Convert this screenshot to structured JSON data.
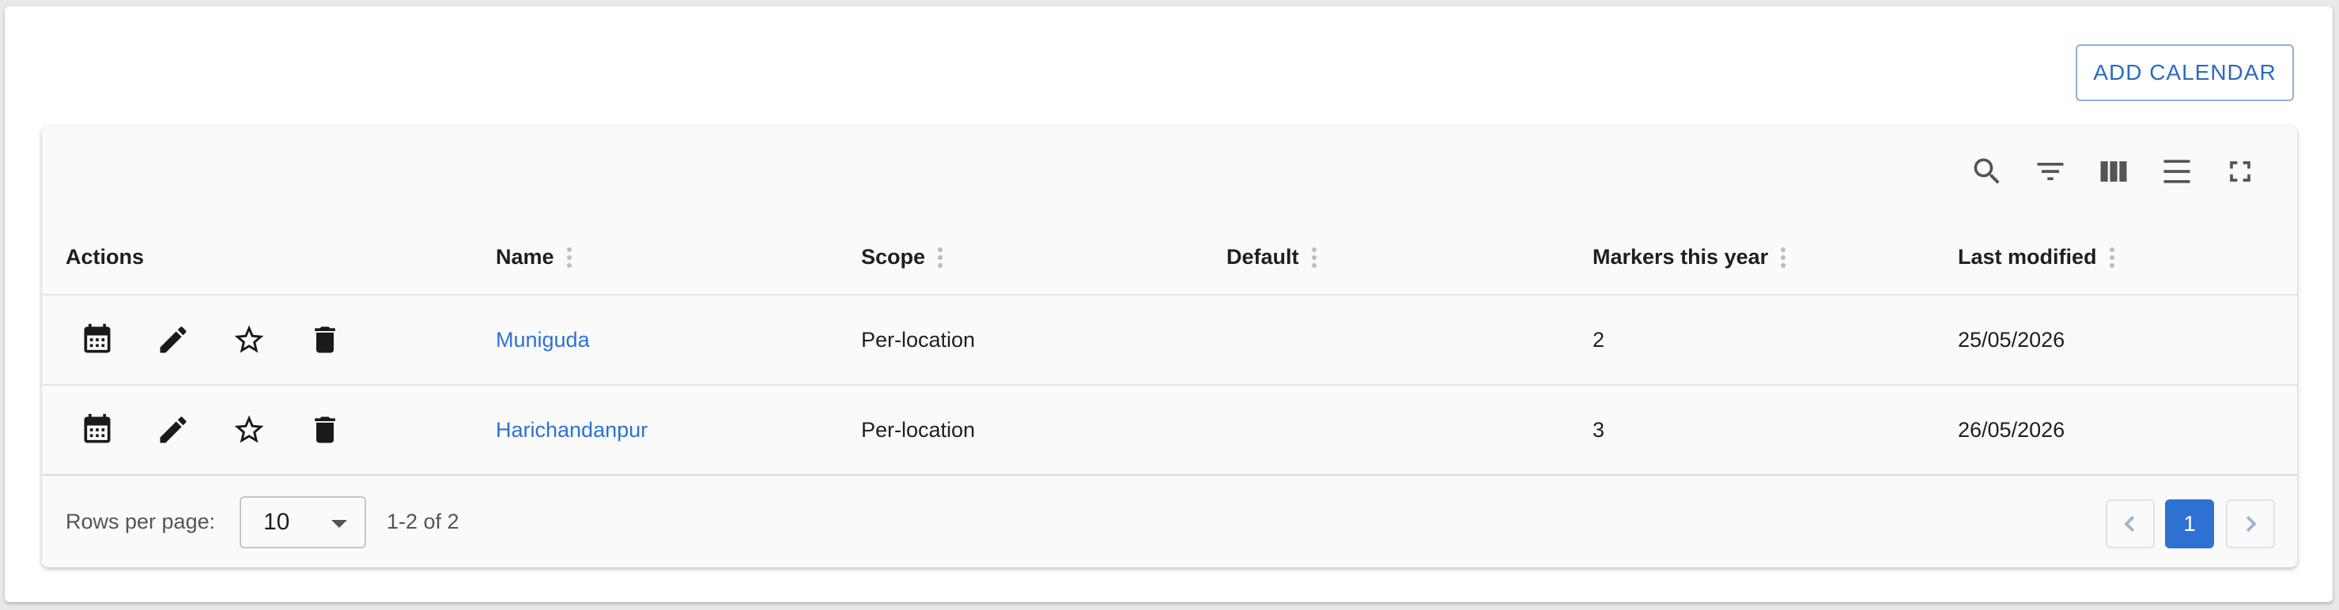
{
  "header": {
    "add_button": "ADD CALENDAR"
  },
  "toolbar": {
    "icons": [
      "search-icon",
      "filter-icon",
      "columns-icon",
      "density-icon",
      "fullscreen-icon"
    ]
  },
  "table": {
    "columns": [
      "Actions",
      "Name",
      "Scope",
      "Default",
      "Markers this year",
      "Last modified"
    ],
    "row_actions": [
      "calendar-icon",
      "edit-icon",
      "star-outline-icon",
      "delete-icon"
    ],
    "rows": [
      {
        "name": "Muniguda",
        "scope": "Per-location",
        "default": "",
        "markers": "2",
        "modified": "25/05/2026"
      },
      {
        "name": "Harichandanpur",
        "scope": "Per-location",
        "default": "",
        "markers": "3",
        "modified": "26/05/2026"
      }
    ]
  },
  "footer": {
    "rows_per_page_label": "Rows per page:",
    "rows_per_page_value": "10",
    "range_text": "1-2 of 2",
    "current_page": "1"
  },
  "colors": {
    "accent": "#2d72d2",
    "button_text": "#2d6ac0",
    "card_bg": "#fafafa"
  }
}
